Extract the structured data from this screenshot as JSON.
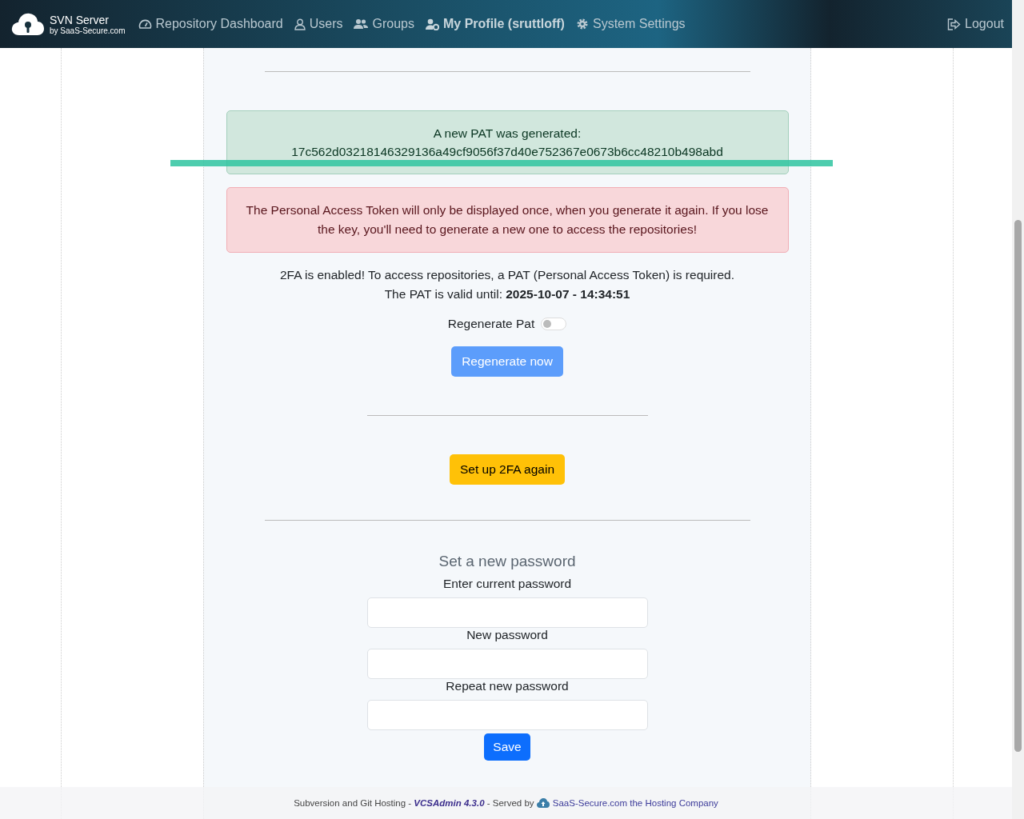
{
  "brand": {
    "title": "SVN Server",
    "subtitle": "by SaaS-Secure.com"
  },
  "nav": [
    {
      "label": "Repository Dashboard",
      "selected": false
    },
    {
      "label": "Users",
      "selected": false
    },
    {
      "label": "Groups",
      "selected": false
    },
    {
      "label": "My Profile (sruttloff)",
      "selected": true
    },
    {
      "label": "System Settings",
      "selected": false
    }
  ],
  "logout": "Logout",
  "success_alert": {
    "title": "A new PAT was generated:",
    "token": "17c562d03218146329136a49cf9056f37d40e752367e0673b6cc48210b498abd"
  },
  "warning_alert": "The Personal Access Token will only be displayed once, when you generate it again. If you lose the key, you'll need to generate a new one to access the repositories!",
  "info": {
    "line_1": "2FA is enabled! To access repositories, a PAT (Personal Access Token) is required.",
    "line_2": "The PAT is valid until: **2025-10-07 - 14:34:51**"
  },
  "regenerate_toggle": {
    "label": "Regenerate Pat",
    "on": false
  },
  "regenerate_button": {
    "label": "Regenerate now",
    "disabled": true
  },
  "twofa_button": "Set up 2FA again",
  "password": {
    "heading": "Set a new password",
    "fields": [
      {
        "label": "Enter current password"
      },
      {
        "label": "New password"
      },
      {
        "label": "Repeat new password"
      }
    ],
    "save": "Save"
  },
  "footer": {
    "text": "Subversion and Git Hosting - ",
    "product": "VCSAdmin 4.3.0",
    "served": " - Served by ",
    "link": "SaaS-Secure.com the Hosting Company"
  }
}
